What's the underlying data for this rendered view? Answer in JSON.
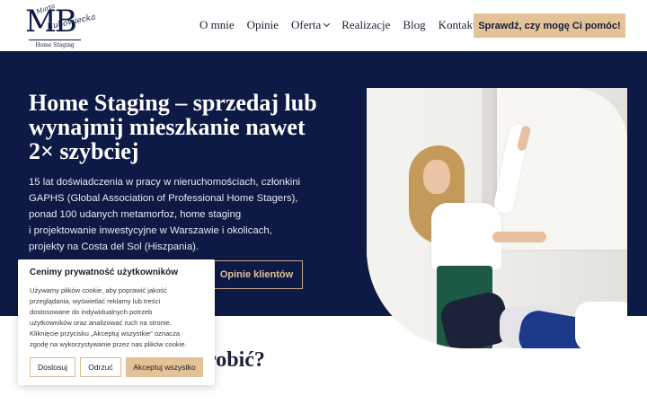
{
  "header": {
    "logo": {
      "monogram": "MB",
      "script_top": "Marta",
      "script": "Bukowiecka",
      "subtitle": "Home Staging"
    },
    "nav": [
      {
        "label": "O mnie"
      },
      {
        "label": "Opinie"
      },
      {
        "label": "Oferta",
        "has_dropdown": true,
        "icon": "chevron-down-icon"
      },
      {
        "label": "Realizacje"
      },
      {
        "label": "Blog"
      },
      {
        "label": "Kontakt"
      }
    ],
    "cta_label": "Sprawdź, czy mogę Ci pomóc!"
  },
  "hero": {
    "title": "Home Staging – sprzedaj lub wynajmij mieszkanie nawet 2× szybciej",
    "description_lines": [
      "15 lat doświadczenia w pracy w nieruchomościach, członkini",
      "GAPHS (Global Association of Professional Home Stagers),",
      "ponad 100 udanych metamorfoz, home staging",
      "i projektowanie inwestycyjne w Warszawie i okolicach,",
      "projekty na Costa del Sol (Hiszpania)."
    ],
    "secondary_button": "Opinie klientów"
  },
  "section": {
    "heading_partial": "robić?"
  },
  "cookie": {
    "title": "Cenimy prywatność użytkowników",
    "text_lines": [
      "Używamy plików cookie, aby poprawić jakość",
      "przeglądania, wyświetlać reklamy lub treści",
      "dostosowane do indywidualnych potrzeb",
      "użytkowników oraz analizować ruch na stronie.",
      "Kliknięcie przycisku „Akceptuj wszystkie” oznacza",
      "zgodę na wykorzystywanie przez nas plików cookie."
    ],
    "buttons": {
      "customize": "Dostosuj",
      "reject": "Odrzuć",
      "accept": "Akceptuj wszystko"
    }
  },
  "colors": {
    "navy": "#0d1a46",
    "gold": "#e3c297",
    "text_dark": "#1c2036"
  }
}
